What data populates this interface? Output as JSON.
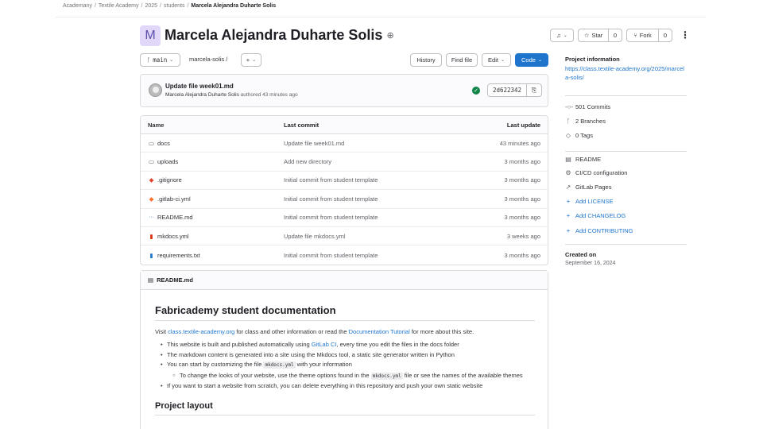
{
  "breadcrumb": [
    "Academany",
    "Textile Academy",
    "2025",
    "students",
    "Marcela Alejandra Duharte Solis"
  ],
  "project": {
    "avatar_letter": "M",
    "title": "Marcela Alejandra Duharte Solis",
    "visibility_icon": "globe-icon"
  },
  "actions": {
    "notifications_icon": "bell-icon",
    "star_label": "Star",
    "star_count": "0",
    "fork_label": "Fork",
    "fork_count": "0"
  },
  "toolbar": {
    "branch": "main",
    "path": "marcela-solis",
    "path_sep": "/",
    "add_label": "+",
    "history": "History",
    "find_file": "Find file",
    "edit": "Edit",
    "code": "Code"
  },
  "last_commit": {
    "title": "Update file week01.md",
    "author": "Marcela Alejandra Duharte Solis",
    "meta": "authored 43 minutes ago",
    "sha": "2d622342"
  },
  "files": {
    "headers": {
      "name": "Name",
      "commit": "Last commit",
      "date": "Last update"
    },
    "rows": [
      {
        "icon": "folder-icon",
        "glyph": "▭",
        "cls": "ico-folder",
        "name": "docs",
        "commit": "Update file week01.md",
        "date": "43 minutes ago"
      },
      {
        "icon": "folder-icon",
        "glyph": "▭",
        "cls": "ico-folder",
        "name": "uploads",
        "commit": "Add new directory",
        "date": "3 months ago"
      },
      {
        "icon": "git-icon",
        "glyph": "◆",
        "cls": "ico-git",
        "name": ".gitignore",
        "commit": "Initial commit from student template",
        "date": "3 months ago"
      },
      {
        "icon": "gitlab-icon",
        "glyph": "◆",
        "cls": "ico-gitlab",
        "name": ".gitlab-ci.yml",
        "commit": "Initial commit from student template",
        "date": "3 months ago"
      },
      {
        "icon": "markdown-icon",
        "glyph": "⋯",
        "cls": "ico-md",
        "name": "README.md",
        "commit": "Initial commit from student template",
        "date": "3 months ago"
      },
      {
        "icon": "yaml-icon",
        "glyph": "▮",
        "cls": "ico-yml",
        "name": "mkdocs.yml",
        "commit": "Update file mkdocs.yml",
        "date": "3 weeks ago"
      },
      {
        "icon": "text-file-icon",
        "glyph": "▮",
        "cls": "ico-txt",
        "name": "requirements.txt",
        "commit": "Initial commit from student template",
        "date": "3 months ago"
      }
    ]
  },
  "readme": {
    "file": "README.md",
    "h1": "Fabricademy student documentation",
    "intro_pre": "Visit ",
    "intro_link1": "class.textile-academy.org",
    "intro_mid": " for class and other information or read the ",
    "intro_link2": "Documentation Tutorial",
    "intro_post": " for more about this site.",
    "b1_pre": "This website is built and published automatically using ",
    "b1_link": "GitLab CI",
    "b1_post": ", every time you edit the files in the docs folder",
    "b2": "The markdown content is generated into a site using the Mkdocs tool, a static site generator written in Python",
    "b3_pre": "You can start by customizing the file ",
    "b3_code": "mkdocs.yml",
    "b3_post": " with your information",
    "b3a_pre": "To change the looks of your website, use the theme options found in the ",
    "b3a_code": "mkdocs.yml",
    "b3a_post": " file or see the names of the available themes",
    "b4": "If you want to start a website from scratch, you can delete everything in this repository and push your own static website",
    "h2": "Project layout"
  },
  "sidebar": {
    "info_title": "Project information",
    "info_link": "https://class.textile-academy.org/2025/marcela-solis/",
    "stats": [
      {
        "icon": "commit-icon",
        "glyph": "-○-",
        "label": "501 Commits"
      },
      {
        "icon": "branch-icon",
        "glyph": "ᚴ",
        "label": "2 Branches"
      },
      {
        "icon": "tag-icon",
        "glyph": "◇",
        "label": "0 Tags"
      }
    ],
    "links": [
      {
        "icon": "doc-icon",
        "glyph": "▤",
        "label": "README",
        "blue": false
      },
      {
        "icon": "cicd-icon",
        "glyph": "⚙",
        "label": "CI/CD configuration",
        "blue": false
      },
      {
        "icon": "external-link-icon",
        "glyph": "↗",
        "label": "GitLab Pages",
        "blue": false
      },
      {
        "icon": "plus-icon",
        "glyph": "+",
        "label": "Add LICENSE",
        "blue": true
      },
      {
        "icon": "plus-icon",
        "glyph": "+",
        "label": "Add CHANGELOG",
        "blue": true
      },
      {
        "icon": "plus-icon",
        "glyph": "+",
        "label": "Add CONTRIBUTING",
        "blue": true
      }
    ],
    "created_title": "Created on",
    "created_date": "September 16, 2024"
  }
}
